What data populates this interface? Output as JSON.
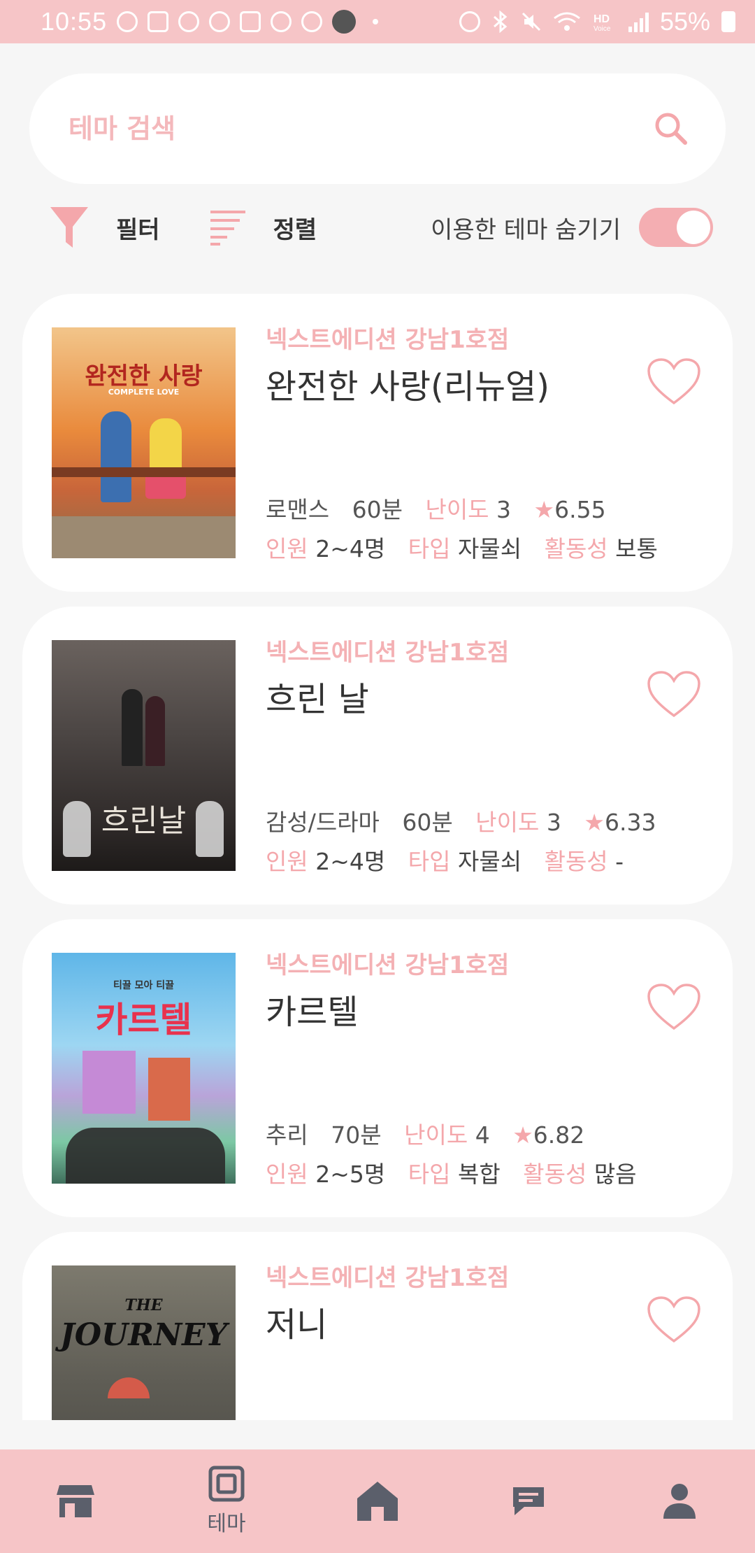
{
  "status_bar": {
    "time": "10:55",
    "battery": "55%",
    "icons": [
      "timer-icon",
      "message-icon",
      "talk-icon",
      "c-icon",
      "note-icon",
      "alarm-icon",
      "g-icon",
      "avatar-icon",
      "dot-icon",
      "alarm-icon",
      "bluetooth-icon",
      "mute-icon",
      "wifi-icon",
      "hd-voice-icon",
      "signal-icon",
      "battery-icon"
    ]
  },
  "search": {
    "placeholder": "테마 검색"
  },
  "controls": {
    "filter_label": "필터",
    "sort_label": "정렬",
    "hide_used_label": "이용한 테마 숨기기",
    "hide_used_on": true
  },
  "labels": {
    "difficulty": "난이도",
    "people": "인원",
    "type": "타입",
    "activity": "활동성",
    "star": "★"
  },
  "themes": [
    {
      "store": "넥스트에디션 강남1호점",
      "name": "완전한 사랑(리뉴얼)",
      "genre": "로맨스",
      "time": "60분",
      "difficulty": "3",
      "rating": "6.55",
      "people": "2~4명",
      "type": "자물쇠",
      "activity": "보통",
      "poster_text": "완전한 사랑",
      "poster_sub": "COMPLETE LOVE"
    },
    {
      "store": "넥스트에디션 강남1호점",
      "name": "흐린 날",
      "genre": "감성/드라마",
      "time": "60분",
      "difficulty": "3",
      "rating": "6.33",
      "people": "2~4명",
      "type": "자물쇠",
      "activity": "-",
      "poster_text": "흐린날"
    },
    {
      "store": "넥스트에디션 강남1호점",
      "name": "카르텔",
      "genre": "추리",
      "time": "70분",
      "difficulty": "4",
      "rating": "6.82",
      "people": "2~5명",
      "type": "복합",
      "activity": "많음",
      "poster_text": "카르텔",
      "poster_sub": "티끌 모아 티끌"
    },
    {
      "store": "넥스트에디션 강남1호점",
      "name": "저니",
      "poster_text": "JOURNEY",
      "poster_sub": "THE"
    }
  ],
  "bottom_nav": {
    "items": [
      {
        "icon": "store-icon",
        "label": ""
      },
      {
        "icon": "theme-icon",
        "label": "테마"
      },
      {
        "icon": "home-icon",
        "label": ""
      },
      {
        "icon": "chat-icon",
        "label": ""
      },
      {
        "icon": "profile-icon",
        "label": ""
      }
    ]
  },
  "colors": {
    "accent": "#f4a7ab",
    "bar": "#f6c5c7",
    "background": "#f6f6f6",
    "nav_icon": "#5b5f6b"
  }
}
